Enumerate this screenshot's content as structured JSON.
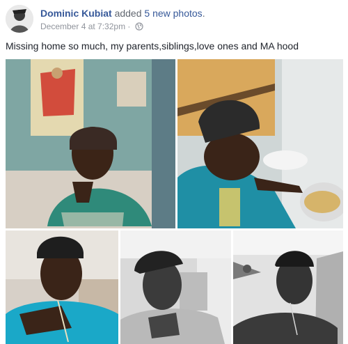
{
  "post": {
    "author": "Dominic Kubiat",
    "action_prefix": "added",
    "photo_count_text": "5 new photos",
    "action_suffix": ".",
    "timestamp": "December 4 at 7:32pm",
    "separator": "·",
    "privacy_icon": "globe-icon",
    "status_text": "Missing home so much, my parents,siblings,love ones and MA hood"
  },
  "photos": [
    {
      "name": "photo-1",
      "subject": "man in dark cap and green t-shirt selfie, poster on wall"
    },
    {
      "name": "photo-2",
      "subject": "man in cap cooking at a pot"
    },
    {
      "name": "photo-3",
      "subject": "man in backwards cap, blue shirt"
    },
    {
      "name": "photo-4",
      "subject": "man in cap, black and white"
    },
    {
      "name": "photo-5",
      "subject": "shirtless man, black and white"
    }
  ],
  "colors": {
    "link": "#365899",
    "text": "#1d2129",
    "meta": "#90949c"
  }
}
